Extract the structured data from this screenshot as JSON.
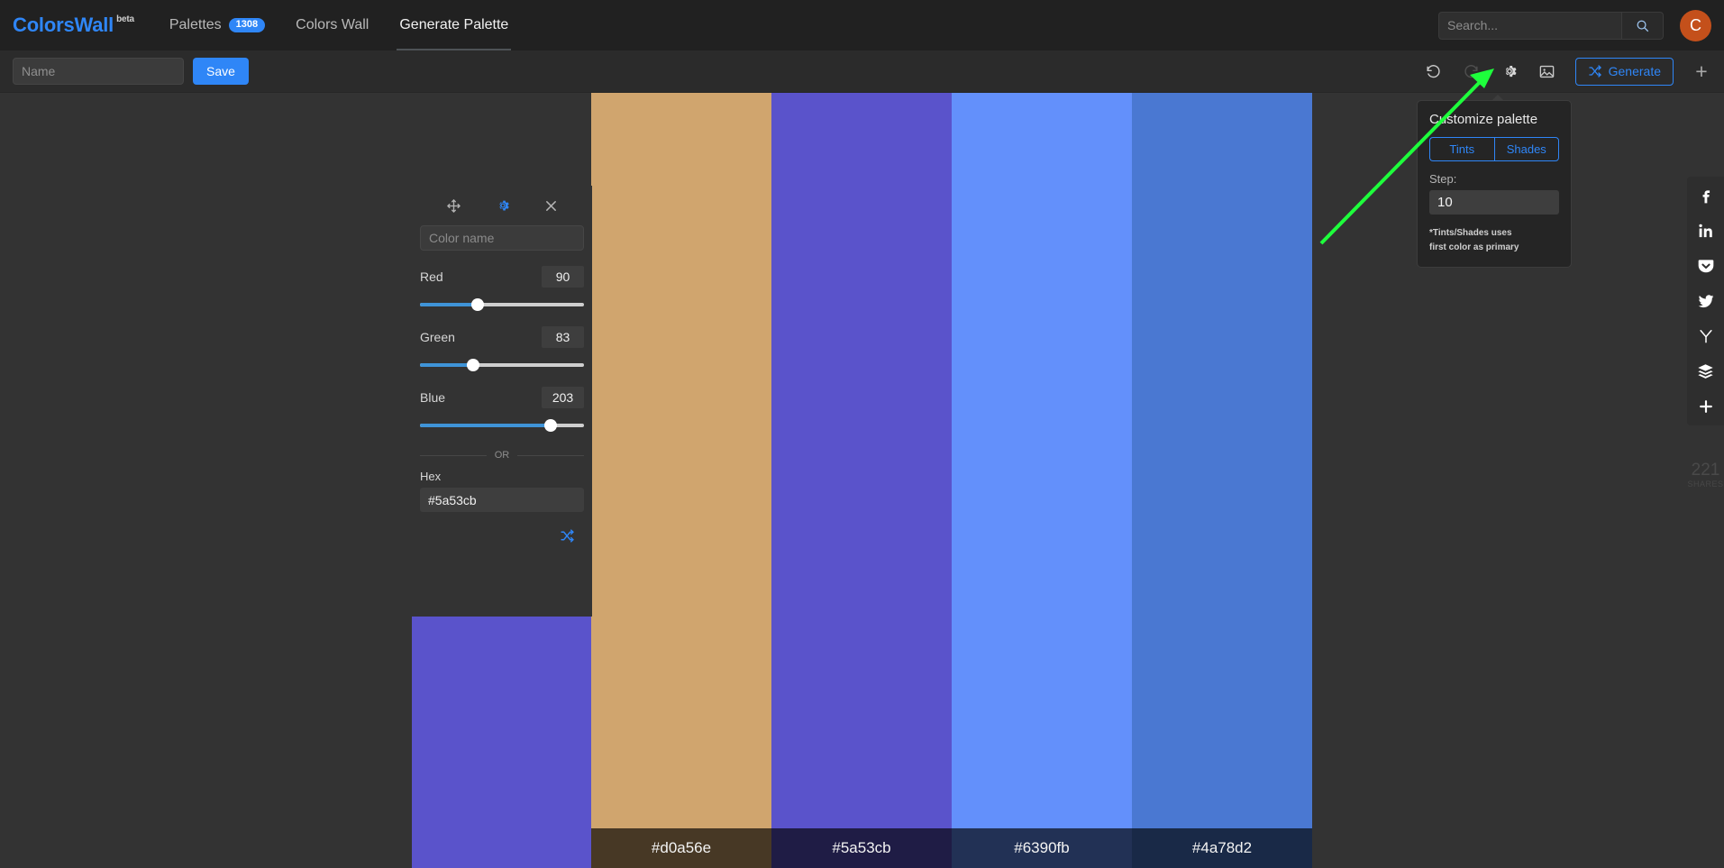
{
  "navbar": {
    "brand": "ColorsWall",
    "brand_sup": "beta",
    "tabs": [
      {
        "label": "Palettes",
        "badge": "1308",
        "active": false
      },
      {
        "label": "Colors Wall",
        "badge": null,
        "active": false
      },
      {
        "label": "Generate Palette",
        "badge": null,
        "active": true
      }
    ],
    "search": {
      "placeholder": "Search...",
      "value": ""
    },
    "search_icon": "search-icon",
    "avatar_initial": "C"
  },
  "toolbar": {
    "name_placeholder": "Name",
    "name_value": "",
    "save_label": "Save",
    "icons": [
      {
        "name": "undo-icon",
        "state": "enabled"
      },
      {
        "name": "redo-icon",
        "state": "disabled"
      },
      {
        "name": "gear-icon",
        "state": "active"
      },
      {
        "name": "image-icon",
        "state": "enabled"
      }
    ],
    "generate_label": "Generate",
    "generate_icon": "shuffle-icon",
    "add_label": "+"
  },
  "editor": {
    "head_icons": [
      {
        "name": "move-icon"
      },
      {
        "name": "gear-icon"
      },
      {
        "name": "close-icon"
      }
    ],
    "color_name_placeholder": "Color name",
    "color_name_value": "",
    "channels": [
      {
        "label": "Red",
        "value": "90"
      },
      {
        "label": "Green",
        "value": "83"
      },
      {
        "label": "Blue",
        "value": "203"
      }
    ],
    "or_label": "OR",
    "hex_label": "Hex",
    "hex_value": "#5a53cb",
    "shuffle_icon": "shuffle-icon",
    "preview_color": "#5a53cb"
  },
  "palette": {
    "swatches": [
      {
        "hex": "#d0a56e"
      },
      {
        "hex": "#5a53cb"
      },
      {
        "hex": "#6390fb"
      },
      {
        "hex": "#4a78d2"
      }
    ]
  },
  "popover": {
    "title": "Customize palette",
    "tints_label": "Tints",
    "shades_label": "Shades",
    "step_label": "Step:",
    "step_value": "10",
    "note_line1": "*Tints/Shades uses",
    "note_line2": "first color as primary"
  },
  "social": {
    "icons": [
      {
        "name": "facebook-icon"
      },
      {
        "name": "linkedin-icon"
      },
      {
        "name": "pocket-icon"
      },
      {
        "name": "twitter-icon"
      },
      {
        "name": "ycombinator-icon"
      },
      {
        "name": "buffer-icon"
      },
      {
        "name": "share-more-icon"
      }
    ],
    "shares_count": "221",
    "shares_label": "SHARES"
  },
  "annotation": {
    "arrow_color": "#1eff3c"
  }
}
